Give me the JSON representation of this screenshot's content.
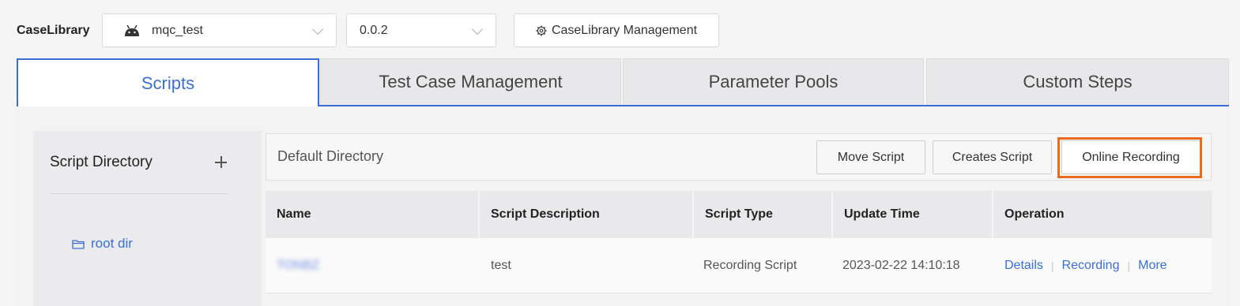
{
  "toolbar": {
    "library_label": "CaseLibrary",
    "app_select": {
      "value": "mqc_test",
      "icon": "android-icon"
    },
    "version_select": {
      "value": "0.0.2"
    },
    "management_button": "CaseLibrary Management"
  },
  "tabs": [
    {
      "label": "Scripts",
      "active": true
    },
    {
      "label": "Test Case Management",
      "active": false
    },
    {
      "label": "Parameter Pools",
      "active": false
    },
    {
      "label": "Custom Steps",
      "active": false
    }
  ],
  "sidebar": {
    "title": "Script Directory",
    "items": [
      {
        "label": "root dir",
        "icon": "folder-icon"
      }
    ]
  },
  "main": {
    "directory_title": "Default Directory",
    "buttons": {
      "move": "Move Script",
      "create": "Creates Script",
      "online_recording": "Online Recording"
    }
  },
  "table": {
    "columns": [
      "Name",
      "Script Description",
      "Script Type",
      "Update Time",
      "Operation"
    ],
    "rows": [
      {
        "name": "TONBZ",
        "description": "test",
        "type": "Recording Script",
        "update_time": "2023-02-22 14:10:18",
        "ops": [
          "Details",
          "Recording",
          "More"
        ]
      }
    ]
  },
  "colors": {
    "accent": "#3b6fd8",
    "highlight": "#ec6a1e"
  }
}
